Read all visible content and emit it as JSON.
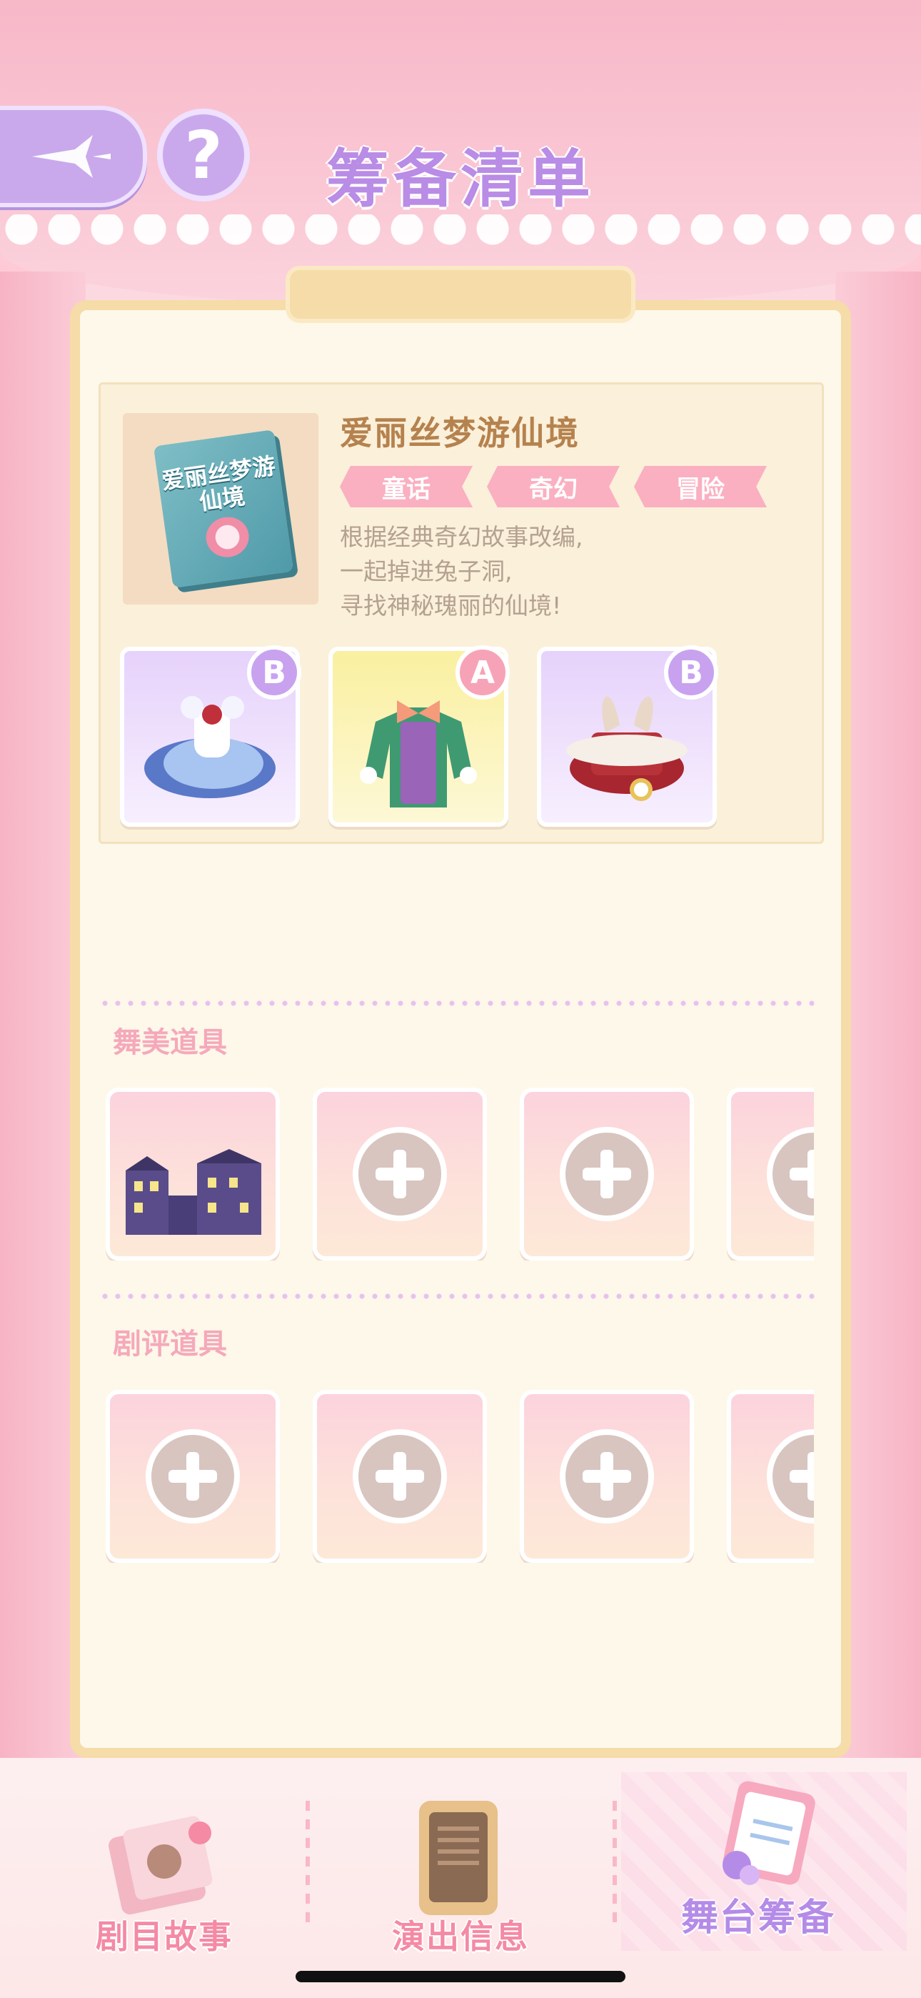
{
  "header": {
    "title": "筹备清单",
    "back_icon": "sparkle-arrow-icon",
    "help_label": "?"
  },
  "script": {
    "book_title": "爱丽丝梦游仙境",
    "name": "爱丽丝梦游仙境",
    "tags": [
      "童话",
      "奇幻",
      "冒险"
    ],
    "description": [
      "根据经典奇幻故事改编,",
      "一起掉进兔子洞,",
      "寻找神秘瑰丽的仙境!"
    ],
    "costumes": [
      {
        "grade": "B",
        "bg": "#ead9fb",
        "icon": "blue-dress-icon"
      },
      {
        "grade": "A",
        "bg": "#fbf2a6",
        "icon": "green-suit-icon"
      },
      {
        "grade": "B",
        "bg": "#ead9fb",
        "icon": "rabbit-hat-icon"
      }
    ]
  },
  "sections": {
    "stage_props": {
      "label": "舞美道具",
      "slots": [
        "house-scene-icon",
        "add-icon",
        "add-icon",
        "add-icon"
      ]
    },
    "review_props": {
      "label": "剧评道具",
      "slots": [
        "add-icon",
        "add-icon",
        "add-icon",
        "add-icon"
      ]
    }
  },
  "nav": {
    "items": [
      {
        "label": "剧目故事",
        "icon": "storybook-icon"
      },
      {
        "label": "演出信息",
        "icon": "notice-board-icon"
      },
      {
        "label": "舞台筹备",
        "icon": "clipboard-icon",
        "active": true
      }
    ]
  },
  "colors": {
    "accent_purple": "#b98ce6",
    "accent_pink": "#f48aa4",
    "tag_pink": "#fab0c1",
    "board_frame": "#f5dca8"
  }
}
